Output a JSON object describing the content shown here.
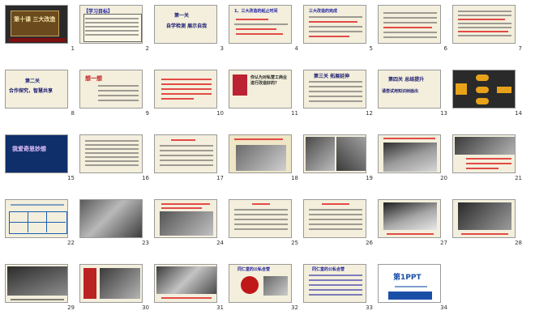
{
  "slides": [
    {
      "n": "1",
      "title": "第十课 三大改造"
    },
    {
      "n": "2",
      "title": "【学习目标】"
    },
    {
      "n": "3",
      "title": "第一关",
      "subtitle": "自学检测  展示自我"
    },
    {
      "n": "4",
      "title": "1、三大改造的起止时间"
    },
    {
      "n": "5",
      "title": "三大改造的完成"
    },
    {
      "n": "6",
      "title": ""
    },
    {
      "n": "7",
      "title": ""
    },
    {
      "n": "8",
      "title": "第二关",
      "subtitle": "合作探究，智慧共享"
    },
    {
      "n": "9",
      "title": "想一想"
    },
    {
      "n": "10",
      "title": ""
    },
    {
      "n": "11",
      "title": "你认为对私营工商业进行改造好的？"
    },
    {
      "n": "12",
      "title": "第三关 拓展延伸"
    },
    {
      "n": "13",
      "title": "第四关 总结提升",
      "subtitle": "请尝试用知识树画出"
    },
    {
      "n": "14",
      "title": ""
    },
    {
      "n": "15",
      "title": "我爱奇思妙想"
    },
    {
      "n": "16",
      "title": ""
    },
    {
      "n": "17",
      "title": ""
    },
    {
      "n": "18",
      "title": ""
    },
    {
      "n": "19",
      "title": ""
    },
    {
      "n": "20",
      "title": ""
    },
    {
      "n": "21",
      "title": ""
    },
    {
      "n": "22",
      "title": ""
    },
    {
      "n": "23",
      "title": ""
    },
    {
      "n": "24",
      "title": ""
    },
    {
      "n": "25",
      "title": ""
    },
    {
      "n": "26",
      "title": ""
    },
    {
      "n": "27",
      "title": ""
    },
    {
      "n": "28",
      "title": ""
    },
    {
      "n": "29",
      "title": ""
    },
    {
      "n": "30",
      "title": ""
    },
    {
      "n": "31",
      "title": ""
    },
    {
      "n": "32",
      "title": "同仁堂的公私合营"
    },
    {
      "n": "33",
      "title": "同仁堂的公私合营"
    },
    {
      "n": "34",
      "title": "第1PPT"
    }
  ]
}
